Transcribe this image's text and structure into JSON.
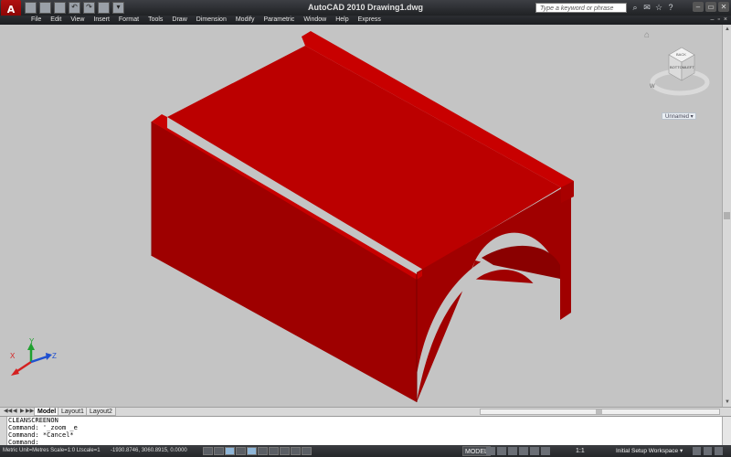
{
  "app": {
    "logo_letter": "A",
    "title": "AutoCAD 2010    Drawing1.dwg"
  },
  "qat": {
    "icons": [
      "new-icon",
      "open-icon",
      "save-icon",
      "undo-icon",
      "redo-icon",
      "plot-icon",
      "dropdown-icon"
    ]
  },
  "search": {
    "placeholder": "Type a keyword or phrase"
  },
  "window_controls": {
    "minimize": "–",
    "restore": "▭",
    "close": "✕"
  },
  "menu": {
    "items": [
      "File",
      "Edit",
      "View",
      "Insert",
      "Format",
      "Tools",
      "Draw",
      "Dimension",
      "Modify",
      "Parametric",
      "Window",
      "Help",
      "Express"
    ]
  },
  "viewcube": {
    "top_label": "BACK",
    "front_label": "BOTTOM",
    "side_label": "LEFT",
    "compass": "W"
  },
  "viewport_label": "Unnamed",
  "ucs": {
    "x": "X",
    "y": "Y",
    "z": "Z"
  },
  "tabs": {
    "model": "Model",
    "layout1": "Layout1",
    "layout2": "Layout2"
  },
  "command": {
    "lines": [
      "CLEANSCREENON",
      "Command: '_zoom _e",
      "Command: *Cancel*",
      "Command:"
    ]
  },
  "status": {
    "units": "Metric  Unit=Metres  Scale=1:0  Ltscale=1",
    "coords": "-1930.8746, 3060.8915, 0.0000",
    "model": "MODEL",
    "annotation_scale": "1:1",
    "workspace": "Initial Setup Workspace ▾"
  },
  "colors": {
    "solid": "#c00000",
    "background": "#c4c4c4"
  }
}
